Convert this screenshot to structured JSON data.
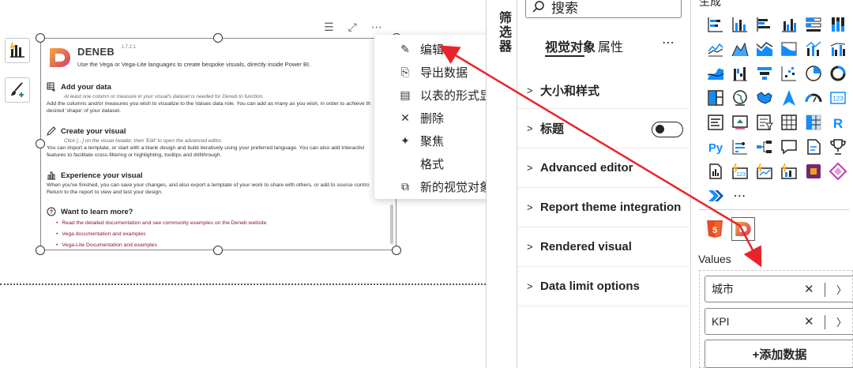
{
  "colors": {
    "arrow": "#e8242b",
    "deneb_orange": "#f07c30",
    "deneb_pink": "#d23c64",
    "html5": "#e44d26",
    "accent_blue": "#118dff",
    "link": "#8a1538"
  },
  "visual": {
    "logo_text": "DENEB",
    "version": "1.7.2.1",
    "subtitle": "Use the Vega or Vega-Lite languages to create bespoke visuals, directly inside Power BI.",
    "sections": [
      {
        "icon": "table-add-icon",
        "title": "Add your data",
        "hint": "At least one column or measure in your visual's dataset is needed for Deneb to function.",
        "lines": [
          "Add the columns and/or measures you wish to visualize to the Values data role. You can add as many as you wish, in order to achieve th",
          "desired 'shape' of your dataset."
        ]
      },
      {
        "icon": "pencil-icon",
        "title": "Create your visual",
        "hint": "Click [...] on the visual header, then 'Edit' to open the advanced editor.",
        "lines": [
          "You can import a template, or start with a blank design and build iteratively using your preferred language. You can also add interactivi",
          "features to facilitate cross-filtering or highlighting, tooltips and drillthrough."
        ]
      },
      {
        "icon": "chart-icon",
        "title": "Experience your visual",
        "hint": "",
        "lines": [
          "When you've finished, you can save your changes, and also export a template of your work to share with others, or add to source contro",
          "Return to the report to view and test your design."
        ]
      },
      {
        "icon": "question-icon",
        "title": "Want to learn more?",
        "hint": "",
        "lines": []
      }
    ],
    "links": [
      "Read the detailed documentation and see community examples on the Deneb website",
      "Vega documentation and examples",
      "Vega-Lite Documentation and examples"
    ]
  },
  "visual_header": {
    "filter_icon": "☰",
    "focus_icon": "⤢",
    "more_icon": "⋯"
  },
  "context_menu": {
    "items": [
      {
        "name": "edit",
        "icon": "✎",
        "label": "编辑",
        "submenu": false
      },
      {
        "name": "export-data",
        "icon": "⎘",
        "label": "导出数据",
        "submenu": false
      },
      {
        "name": "show-as-table",
        "icon": "▤",
        "label": "以表的形式显示",
        "submenu": false
      },
      {
        "name": "delete",
        "icon": "✕",
        "label": "删除",
        "submenu": false
      },
      {
        "name": "spotlight",
        "icon": "✦",
        "label": "聚焦",
        "submenu": false
      },
      {
        "name": "format",
        "icon": "",
        "label": "格式",
        "submenu": false
      },
      {
        "name": "new-visual-calc",
        "icon": "⧉",
        "label": "新的视觉对象计算",
        "submenu": true
      }
    ]
  },
  "filter_strip": {
    "label": "筛选器"
  },
  "format_pane": {
    "search_label": "搜索",
    "tabs": [
      {
        "label": "视觉对象",
        "active": true
      },
      {
        "label": "属性",
        "active": false
      }
    ],
    "more": "⋯",
    "sections": [
      {
        "label": "大小和样式",
        "chevron": ">"
      },
      {
        "label": "标题",
        "chevron": ">"
      },
      {
        "label": "Advanced editor",
        "chevron": ">"
      },
      {
        "label": "Report theme integration",
        "chevron": ">"
      },
      {
        "label": "Rendered visual",
        "chevron": ">"
      },
      {
        "label": "Data limit options",
        "chevron": ">"
      }
    ]
  },
  "viz_pane": {
    "title": "生成",
    "values_label": "Values",
    "fields": [
      {
        "label": "城市"
      },
      {
        "label": "KPI"
      }
    ],
    "add_data_label": "+添加数据",
    "more": "⋯"
  }
}
